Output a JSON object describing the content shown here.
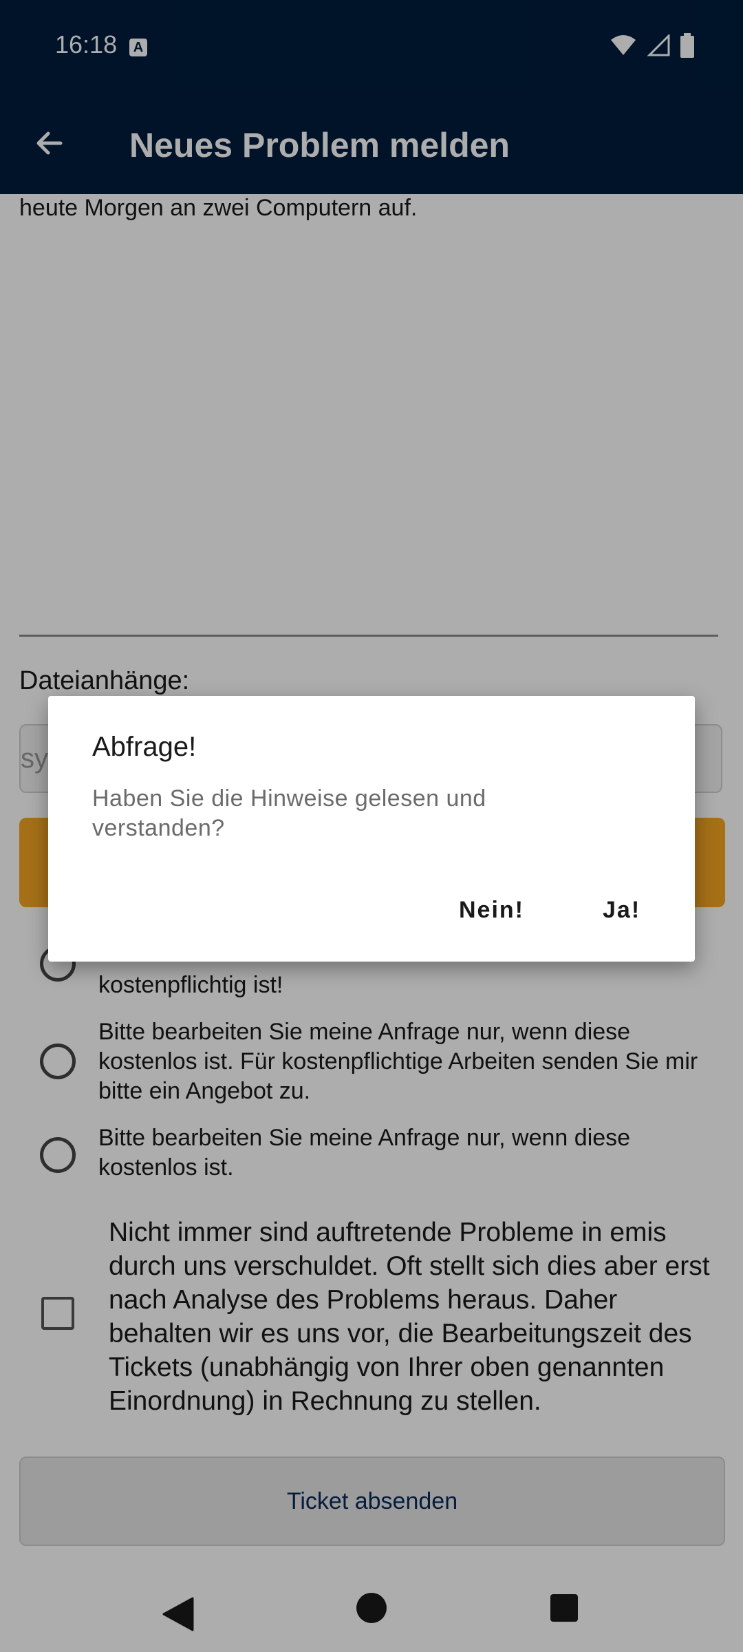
{
  "status_bar": {
    "time": "16:18",
    "notification_icon": "a-icon",
    "icons": [
      "wifi-icon",
      "signal-icon",
      "battery-icon"
    ]
  },
  "app_bar": {
    "title": "Neues Problem melden",
    "back_icon": "arrow-back-icon"
  },
  "form": {
    "description_text": "heute Morgen an zwei Computern auf.",
    "attachments_label": "Dateianhänge:",
    "attachments_placeholder": "sy",
    "radio_options": [
      "kostenpflichtig ist!",
      "Bitte bearbeiten Sie meine Anfrage nur, wenn diese kostenlos ist. Für kostenpflichtige Arbeiten senden Sie mir bitte ein Angebot zu.",
      "Bitte bearbeiten Sie meine Anfrage nur, wenn diese kostenlos ist."
    ],
    "disclaimer_text": "Nicht immer sind auftretende Probleme in emis durch uns verschuldet. Oft stellt sich dies aber erst nach Analyse des Problems heraus. Daher behalten wir es uns vor, die Bearbeitungszeit des Tickets (unabhängig von Ihrer oben genannten Einordnung) in Rechnung zu stellen.",
    "submit_label": "Ticket absenden"
  },
  "dialog": {
    "title": "Abfrage!",
    "message": "Haben Sie die Hinweise gelesen und verstanden?",
    "negative_label": "Nein!",
    "positive_label": "Ja!"
  },
  "colors": {
    "primary": "#001d3d",
    "accent": "#f5a623",
    "scrim": "rgba(0,0,0,0.32)"
  }
}
